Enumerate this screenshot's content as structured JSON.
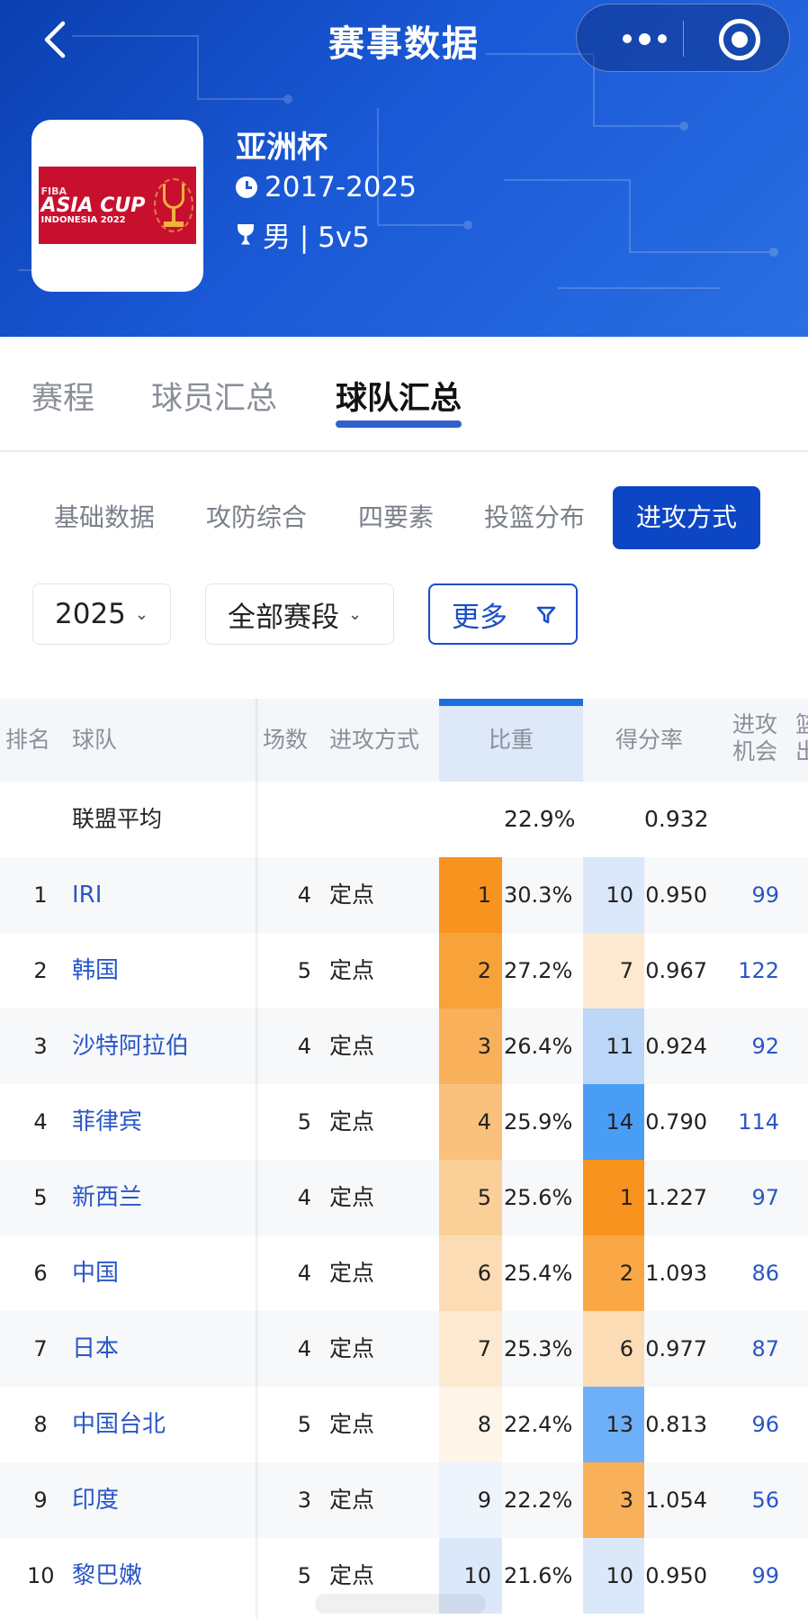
{
  "header": {
    "title": "赛事数据",
    "league_name": "亚洲杯",
    "seasons": "2017-2025",
    "gender_format": "男 | 5v5",
    "logo": {
      "fiba": "FIBA",
      "line1": "ASIA CUP",
      "line2": "INDONESIA 2022"
    }
  },
  "main_tabs": [
    {
      "label": "赛程",
      "active": false
    },
    {
      "label": "球员汇总",
      "active": false
    },
    {
      "label": "球队汇总",
      "active": true
    }
  ],
  "sub_tabs": [
    {
      "label": "基础数据",
      "active": false
    },
    {
      "label": "攻防综合",
      "active": false
    },
    {
      "label": "四要素",
      "active": false
    },
    {
      "label": "投篮分布",
      "active": false
    },
    {
      "label": "进攻方式",
      "active": true
    }
  ],
  "filters": {
    "season": "2025",
    "stage": "全部赛段",
    "more": "更多"
  },
  "table": {
    "headers": {
      "rank": "排名",
      "team": "球队",
      "games": "场数",
      "method": "进攻方式",
      "share": "比重",
      "score_rate": "得分率",
      "possessions_l1": "进攻",
      "possessions_l2": "机会",
      "extra_l1": "篮",
      "extra_l2": "出"
    },
    "average": {
      "label": "联盟平均",
      "share": "22.9%",
      "score_rate": "0.932"
    },
    "rows": [
      {
        "rank": "1",
        "team": "IRI",
        "games": "4",
        "method": "定点",
        "share_rank": "1",
        "share": "30.3%",
        "rate_rank": "10",
        "rate": "0.950",
        "poss": "99"
      },
      {
        "rank": "2",
        "team": "韩国",
        "games": "5",
        "method": "定点",
        "share_rank": "2",
        "share": "27.2%",
        "rate_rank": "7",
        "rate": "0.967",
        "poss": "122"
      },
      {
        "rank": "3",
        "team": "沙特阿拉伯",
        "games": "4",
        "method": "定点",
        "share_rank": "3",
        "share": "26.4%",
        "rate_rank": "11",
        "rate": "0.924",
        "poss": "92"
      },
      {
        "rank": "4",
        "team": "菲律宾",
        "games": "5",
        "method": "定点",
        "share_rank": "4",
        "share": "25.9%",
        "rate_rank": "14",
        "rate": "0.790",
        "poss": "114"
      },
      {
        "rank": "5",
        "team": "新西兰",
        "games": "4",
        "method": "定点",
        "share_rank": "5",
        "share": "25.6%",
        "rate_rank": "1",
        "rate": "1.227",
        "poss": "97"
      },
      {
        "rank": "6",
        "team": "中国",
        "games": "4",
        "method": "定点",
        "share_rank": "6",
        "share": "25.4%",
        "rate_rank": "2",
        "rate": "1.093",
        "poss": "86"
      },
      {
        "rank": "7",
        "team": "日本",
        "games": "4",
        "method": "定点",
        "share_rank": "7",
        "share": "25.3%",
        "rate_rank": "6",
        "rate": "0.977",
        "poss": "87"
      },
      {
        "rank": "8",
        "team": "中国台北",
        "games": "5",
        "method": "定点",
        "share_rank": "8",
        "share": "22.4%",
        "rate_rank": "13",
        "rate": "0.813",
        "poss": "96"
      },
      {
        "rank": "9",
        "team": "印度",
        "games": "3",
        "method": "定点",
        "share_rank": "9",
        "share": "22.2%",
        "rate_rank": "3",
        "rate": "1.054",
        "poss": "56"
      },
      {
        "rank": "10",
        "team": "黎巴嫩",
        "games": "5",
        "method": "定点",
        "share_rank": "10",
        "share": "21.6%",
        "rate_rank": "10",
        "rate": "0.950",
        "poss": "99"
      }
    ]
  },
  "colors": {
    "header_bg": "#1a59d6",
    "accent": "#0c46c4",
    "link": "#2a56c6",
    "share_rank_colors": [
      "#f7931e",
      "#f8a23a",
      "#f9b05a",
      "#fac17c",
      "#fbcf98",
      "#fcdcb4",
      "#fde9cf",
      "#fef4e8",
      "#eef4fc",
      "#dbe8fa"
    ],
    "rate_rank_colors": [
      "#fbe4c8",
      "#f7931e",
      "#f9a845",
      "#d8e7fb",
      "#fde8d0",
      "#4a9df5",
      "#6eb0f7",
      "#c9dcf8"
    ]
  }
}
